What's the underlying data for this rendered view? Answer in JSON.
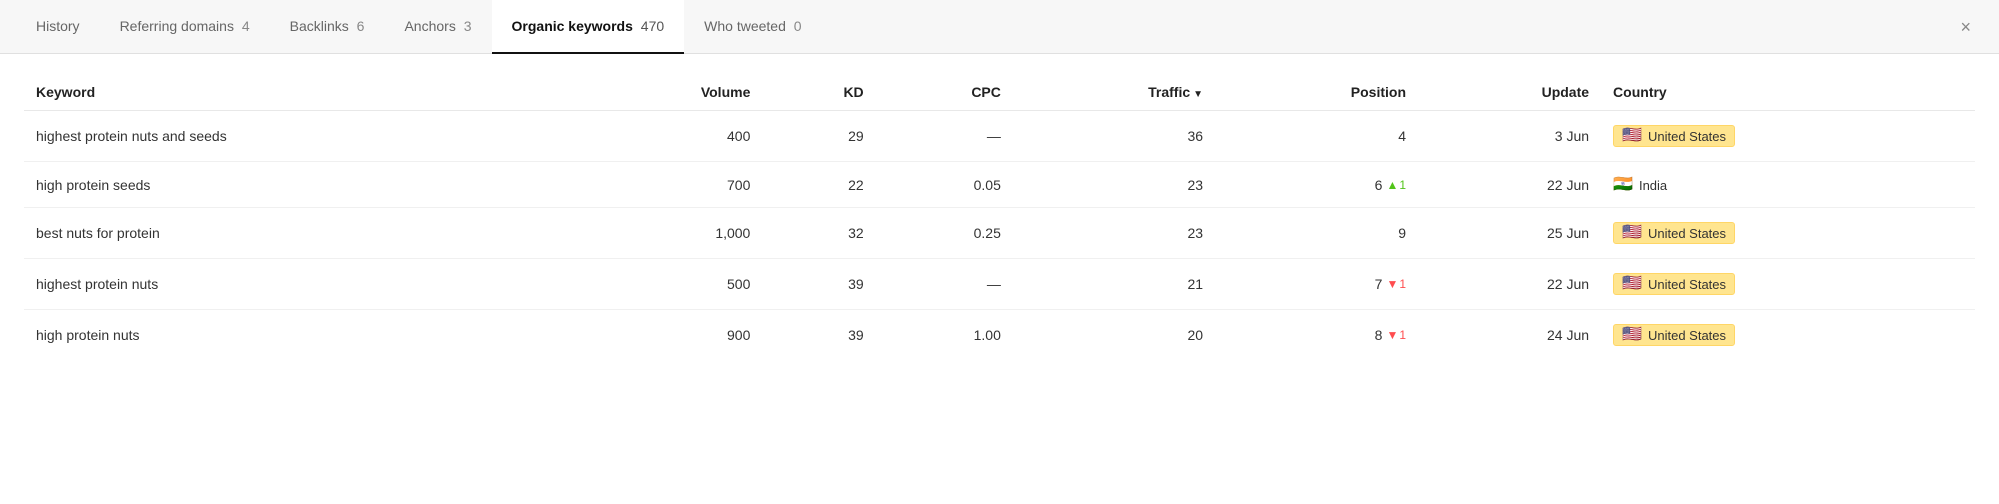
{
  "tabs": [
    {
      "id": "history",
      "label": "History",
      "count": null,
      "active": false
    },
    {
      "id": "referring-domains",
      "label": "Referring domains",
      "count": "4",
      "active": false
    },
    {
      "id": "backlinks",
      "label": "Backlinks",
      "count": "6",
      "active": false
    },
    {
      "id": "anchors",
      "label": "Anchors",
      "count": "3",
      "active": false
    },
    {
      "id": "organic-keywords",
      "label": "Organic keywords",
      "count": "470",
      "active": true
    },
    {
      "id": "who-tweeted",
      "label": "Who tweeted",
      "count": "0",
      "active": false
    }
  ],
  "close_label": "×",
  "table": {
    "columns": [
      {
        "id": "keyword",
        "label": "Keyword",
        "align": "left"
      },
      {
        "id": "volume",
        "label": "Volume",
        "align": "right"
      },
      {
        "id": "kd",
        "label": "KD",
        "align": "right"
      },
      {
        "id": "cpc",
        "label": "CPC",
        "align": "right"
      },
      {
        "id": "traffic",
        "label": "Traffic",
        "align": "right",
        "sort": true
      },
      {
        "id": "position",
        "label": "Position",
        "align": "right"
      },
      {
        "id": "update",
        "label": "Update",
        "align": "right"
      },
      {
        "id": "country",
        "label": "Country",
        "align": "left"
      }
    ],
    "rows": [
      {
        "keyword": "highest protein nuts and seeds",
        "volume": "400",
        "kd": "29",
        "cpc": "—",
        "traffic": "36",
        "position": "4",
        "position_change": null,
        "position_direction": null,
        "update": "3 Jun",
        "country": "United States",
        "country_flag": "🇺🇸",
        "country_highlight": true
      },
      {
        "keyword": "high protein seeds",
        "volume": "700",
        "kd": "22",
        "cpc": "0.05",
        "traffic": "23",
        "position": "6",
        "position_change": "1",
        "position_direction": "up",
        "update": "22 Jun",
        "country": "India",
        "country_flag": "🇮🇳",
        "country_highlight": false
      },
      {
        "keyword": "best nuts for protein",
        "volume": "1,000",
        "kd": "32",
        "cpc": "0.25",
        "traffic": "23",
        "position": "9",
        "position_change": null,
        "position_direction": null,
        "update": "25 Jun",
        "country": "United States",
        "country_flag": "🇺🇸",
        "country_highlight": true
      },
      {
        "keyword": "highest protein nuts",
        "volume": "500",
        "kd": "39",
        "cpc": "—",
        "traffic": "21",
        "position": "7",
        "position_change": "1",
        "position_direction": "down",
        "update": "22 Jun",
        "country": "United States",
        "country_flag": "🇺🇸",
        "country_highlight": true
      },
      {
        "keyword": "high protein nuts",
        "volume": "900",
        "kd": "39",
        "cpc": "1.00",
        "traffic": "20",
        "position": "8",
        "position_change": "1",
        "position_direction": "down",
        "update": "24 Jun",
        "country": "United States",
        "country_flag": "🇺🇸",
        "country_highlight": true
      }
    ]
  }
}
